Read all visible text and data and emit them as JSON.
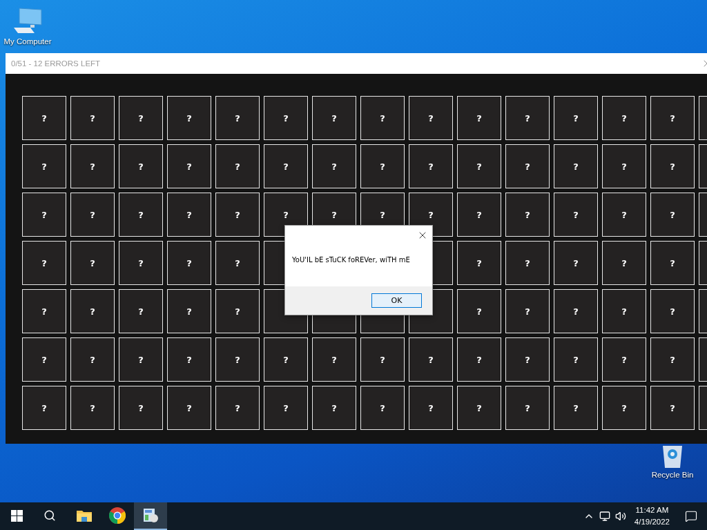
{
  "desktop": {
    "icons": [
      {
        "kind": "computer",
        "label": "My Computer"
      },
      {
        "kind": "recycle",
        "label": "Recycle Bin"
      }
    ]
  },
  "game_window": {
    "title": "0/51 - 12 ERRORS LEFT",
    "grid": [
      {
        "cells": [
          {
            "kind": "mark",
            "label": "?"
          },
          {
            "kind": "mark",
            "label": "?"
          },
          {
            "kind": "mark",
            "label": "?"
          },
          {
            "kind": "mark",
            "label": "?"
          },
          {
            "kind": "mark",
            "label": "?"
          },
          {
            "kind": "mark",
            "label": "?"
          },
          {
            "kind": "mark",
            "label": "?"
          },
          {
            "kind": "mark",
            "label": "?"
          },
          {
            "kind": "mark",
            "label": "?"
          },
          {
            "kind": "mark",
            "label": "?"
          },
          {
            "kind": "mark",
            "label": "?"
          },
          {
            "kind": "mark",
            "label": "?"
          },
          {
            "kind": "mark",
            "label": "?"
          },
          {
            "kind": "mark",
            "label": "?"
          },
          {
            "kind": "blank"
          }
        ]
      },
      {
        "cells": [
          {
            "kind": "mark",
            "label": "?"
          },
          {
            "kind": "mark",
            "label": "?"
          },
          {
            "kind": "mark",
            "label": "?"
          },
          {
            "kind": "mark",
            "label": "?"
          },
          {
            "kind": "mark",
            "label": "?"
          },
          {
            "kind": "mark",
            "label": "?"
          },
          {
            "kind": "mark",
            "label": "?"
          },
          {
            "kind": "mark",
            "label": "?"
          },
          {
            "kind": "mark",
            "label": "?"
          },
          {
            "kind": "mark",
            "label": "?"
          },
          {
            "kind": "mark",
            "label": "?"
          },
          {
            "kind": "mark",
            "label": "?"
          },
          {
            "kind": "mark",
            "label": "?"
          },
          {
            "kind": "mark",
            "label": "?"
          },
          {
            "kind": "blank"
          }
        ]
      },
      {
        "cells": [
          {
            "kind": "mark",
            "label": "?"
          },
          {
            "kind": "mark",
            "label": "?"
          },
          {
            "kind": "mark",
            "label": "?"
          },
          {
            "kind": "mark",
            "label": "?"
          },
          {
            "kind": "mark",
            "label": "?"
          },
          {
            "kind": "mark",
            "label": "?"
          },
          {
            "kind": "mark",
            "label": "?"
          },
          {
            "kind": "mark",
            "label": "?"
          },
          {
            "kind": "mark",
            "label": "?"
          },
          {
            "kind": "mark",
            "label": "?"
          },
          {
            "kind": "mark",
            "label": "?"
          },
          {
            "kind": "mark",
            "label": "?"
          },
          {
            "kind": "mark",
            "label": "?"
          },
          {
            "kind": "mark",
            "label": "?"
          },
          {
            "kind": "blank"
          }
        ]
      },
      {
        "cells": [
          {
            "kind": "mark",
            "label": "?"
          },
          {
            "kind": "mark",
            "label": "?"
          },
          {
            "kind": "mark",
            "label": "?"
          },
          {
            "kind": "mark",
            "label": "?"
          },
          {
            "kind": "mark",
            "label": "?"
          },
          {
            "kind": "blank"
          },
          {
            "kind": "covered"
          },
          {
            "kind": "covered"
          },
          {
            "kind": "blank"
          },
          {
            "kind": "mark",
            "label": "?"
          },
          {
            "kind": "mark",
            "label": "?"
          },
          {
            "kind": "mark",
            "label": "?"
          },
          {
            "kind": "mark",
            "label": "?"
          },
          {
            "kind": "mark",
            "label": "?"
          },
          {
            "kind": "blank"
          }
        ]
      },
      {
        "cells": [
          {
            "kind": "mark",
            "label": "?"
          },
          {
            "kind": "mark",
            "label": "?"
          },
          {
            "kind": "mark",
            "label": "?"
          },
          {
            "kind": "mark",
            "label": "?"
          },
          {
            "kind": "mark",
            "label": "?"
          },
          {
            "kind": "blank"
          },
          {
            "kind": "blank"
          },
          {
            "kind": "blank"
          },
          {
            "kind": "blank"
          },
          {
            "kind": "mark",
            "label": "?"
          },
          {
            "kind": "mark",
            "label": "?"
          },
          {
            "kind": "mark",
            "label": "?"
          },
          {
            "kind": "mark",
            "label": "?"
          },
          {
            "kind": "mark",
            "label": "?"
          },
          {
            "kind": "blank"
          }
        ]
      },
      {
        "cells": [
          {
            "kind": "mark",
            "label": "?"
          },
          {
            "kind": "mark",
            "label": "?"
          },
          {
            "kind": "mark",
            "label": "?"
          },
          {
            "kind": "mark",
            "label": "?"
          },
          {
            "kind": "mark",
            "label": "?"
          },
          {
            "kind": "mark",
            "label": "?"
          },
          {
            "kind": "mark",
            "label": "?"
          },
          {
            "kind": "mark",
            "label": "?"
          },
          {
            "kind": "mark",
            "label": "?"
          },
          {
            "kind": "mark",
            "label": "?"
          },
          {
            "kind": "mark",
            "label": "?"
          },
          {
            "kind": "mark",
            "label": "?"
          },
          {
            "kind": "mark",
            "label": "?"
          },
          {
            "kind": "mark",
            "label": "?"
          },
          {
            "kind": "blank"
          }
        ]
      },
      {
        "cells": [
          {
            "kind": "mark",
            "label": "?"
          },
          {
            "kind": "mark",
            "label": "?"
          },
          {
            "kind": "mark",
            "label": "?"
          },
          {
            "kind": "mark",
            "label": "?"
          },
          {
            "kind": "mark",
            "label": "?"
          },
          {
            "kind": "mark",
            "label": "?"
          },
          {
            "kind": "mark",
            "label": "?"
          },
          {
            "kind": "mark",
            "label": "?"
          },
          {
            "kind": "mark",
            "label": "?"
          },
          {
            "kind": "mark",
            "label": "?"
          },
          {
            "kind": "mark",
            "label": "?"
          },
          {
            "kind": "mark",
            "label": "?"
          },
          {
            "kind": "mark",
            "label": "?"
          },
          {
            "kind": "mark",
            "label": "?"
          },
          {
            "kind": "blank"
          }
        ]
      }
    ]
  },
  "dialog": {
    "message": "YoU'IL bE sTuCK foREVer, wiTH mE",
    "buttons": [
      {
        "label": "OK",
        "selected": true
      }
    ]
  },
  "taskbar": {
    "apps": [
      {
        "kind": "start",
        "selected": false
      },
      {
        "kind": "search",
        "selected": false
      },
      {
        "kind": "explorer",
        "selected": false
      },
      {
        "kind": "chrome",
        "selected": false
      },
      {
        "kind": "app",
        "selected": true
      }
    ],
    "tray": {
      "time": "11:42 AM",
      "date": "4/19/2022"
    }
  }
}
